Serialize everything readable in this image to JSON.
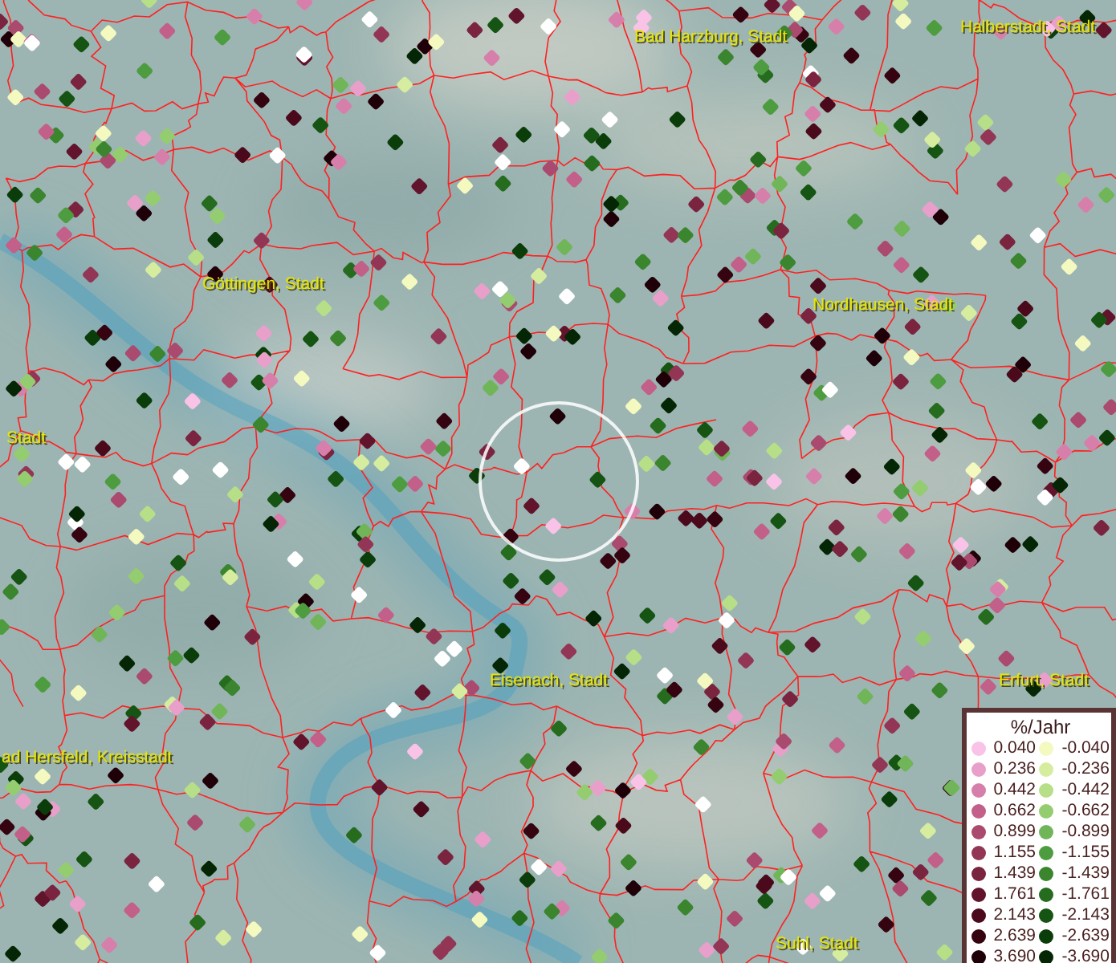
{
  "map": {
    "places": [
      {
        "name": "Bad Harzburg, Stadt"
      },
      {
        "name": "Halberstadt, Stadt"
      },
      {
        "name": "Göttingen, Stadt"
      },
      {
        "name": "Nordhausen, Stadt"
      },
      {
        "name": "Stadt"
      },
      {
        "name": "Eisenach, Stadt"
      },
      {
        "name": "Erfurt, Stadt"
      },
      {
        "name": "ad Hersfeld, Kreisstadt"
      },
      {
        "name": "Suhl, Stadt"
      }
    ]
  },
  "legend": {
    "title": "%/Jahr",
    "rows": [
      {
        "positive": {
          "value": "0.040",
          "color": "#f9c3e8"
        },
        "negative": {
          "value": "-0.040",
          "color": "#f4f9c0"
        }
      },
      {
        "positive": {
          "value": "0.236",
          "color": "#e8a0cb"
        },
        "negative": {
          "value": "-0.236",
          "color": "#d6eda0"
        }
      },
      {
        "positive": {
          "value": "0.442",
          "color": "#d77fab"
        },
        "negative": {
          "value": "-0.442",
          "color": "#b6df88"
        }
      },
      {
        "positive": {
          "value": "0.662",
          "color": "#c2608a"
        },
        "negative": {
          "value": "-0.662",
          "color": "#94cc70"
        }
      },
      {
        "positive": {
          "value": "0.899",
          "color": "#aa4a6e"
        },
        "negative": {
          "value": "-0.899",
          "color": "#70b558"
        }
      },
      {
        "positive": {
          "value": "1.155",
          "color": "#933656"
        },
        "negative": {
          "value": "-1.155",
          "color": "#4e9c40"
        }
      },
      {
        "positive": {
          "value": "1.439",
          "color": "#7a2440"
        },
        "negative": {
          "value": "-1.439",
          "color": "#3a852e"
        }
      },
      {
        "positive": {
          "value": "1.761",
          "color": "#62142c"
        },
        "negative": {
          "value": "-1.761",
          "color": "#266c1e"
        }
      },
      {
        "positive": {
          "value": "2.143",
          "color": "#4a0a1c"
        },
        "negative": {
          "value": "-2.143",
          "color": "#155412"
        }
      },
      {
        "positive": {
          "value": "2.639",
          "color": "#350410"
        },
        "negative": {
          "value": "-2.639",
          "color": "#0a3d0a"
        }
      },
      {
        "positive": {
          "value": "3.690",
          "color": "#200008"
        },
        "negative": {
          "value": "-3.690",
          "color": "#042604"
        }
      }
    ]
  }
}
